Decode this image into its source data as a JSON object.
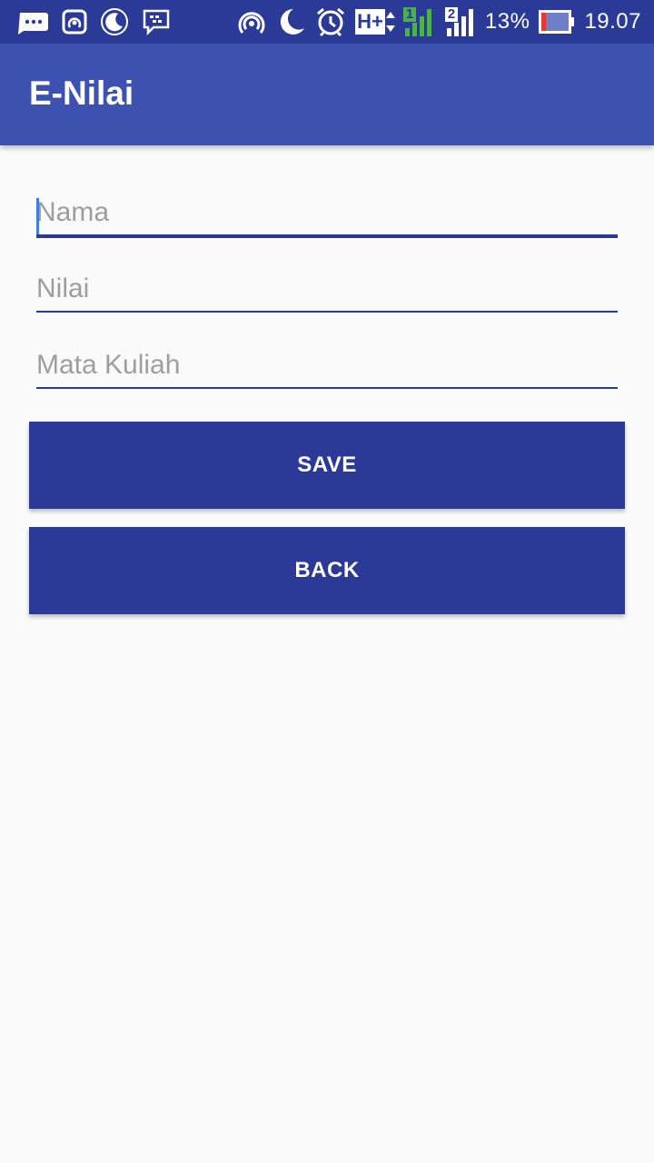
{
  "status_bar": {
    "left_icons": [
      "bbm-chat-icon",
      "sync-icon",
      "night-mode-icon",
      "bbm-messenger-icon"
    ],
    "right_icons": [
      "hotspot-icon",
      "moon-icon",
      "alarm-icon",
      "hplus-network-icon",
      "signal-sim1-icon",
      "signal-sim2-icon",
      "battery-icon"
    ],
    "network": "H+",
    "sim1": "1",
    "sim2": "2",
    "battery_percent": "13%",
    "time": "19.07",
    "colors": {
      "background": "#2b3a97",
      "battery_low": "#e53935",
      "signal_green": "#4caf50"
    }
  },
  "app_bar": {
    "title": "E-Nilai",
    "color": "#3c51b0"
  },
  "form": {
    "fields": [
      {
        "placeholder": "Nama",
        "value": "",
        "focused": true
      },
      {
        "placeholder": "Nilai",
        "value": ""
      },
      {
        "placeholder": "Mata Kuliah",
        "value": ""
      }
    ],
    "save_label": "SAVE",
    "back_label": "BACK",
    "accent": "#2b3a97"
  }
}
